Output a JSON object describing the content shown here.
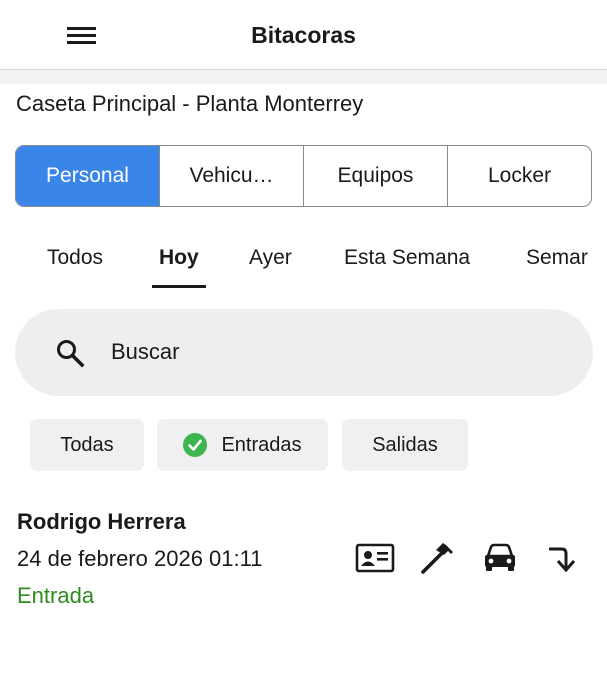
{
  "header": {
    "title": "Bitacoras",
    "menu_icon": "hamburger-menu-icon"
  },
  "location": "Caseta Principal - Planta Monterrey",
  "segments": [
    {
      "label": "Personal",
      "active": true
    },
    {
      "label": "Vehicu…",
      "active": false
    },
    {
      "label": "Equipos",
      "active": false
    },
    {
      "label": "Locker",
      "active": false
    }
  ],
  "period_tabs": [
    {
      "label": "Todos",
      "active": false
    },
    {
      "label": "Hoy",
      "active": true
    },
    {
      "label": "Ayer",
      "active": false
    },
    {
      "label": "Esta Semana",
      "active": false
    },
    {
      "label": "Semar",
      "active": false
    }
  ],
  "search": {
    "placeholder": "Buscar",
    "value": ""
  },
  "filters": [
    {
      "label": "Todas",
      "selected": false
    },
    {
      "label": "Entradas",
      "selected": true,
      "icon": "check-circle-icon"
    },
    {
      "label": "Salidas",
      "selected": false
    }
  ],
  "records": [
    {
      "name": "Rodrigo Herrera",
      "datetime": "24 de febrero 2026 01:11",
      "type": "Entrada",
      "type_color": "#2e8b1e",
      "icons": [
        "id-card-icon",
        "hammer-icon",
        "car-icon",
        "turn-down-arrow-icon"
      ]
    }
  ],
  "colors": {
    "accent": "#3a86e8",
    "success": "#2e8b1e",
    "check": "#3fb552"
  }
}
